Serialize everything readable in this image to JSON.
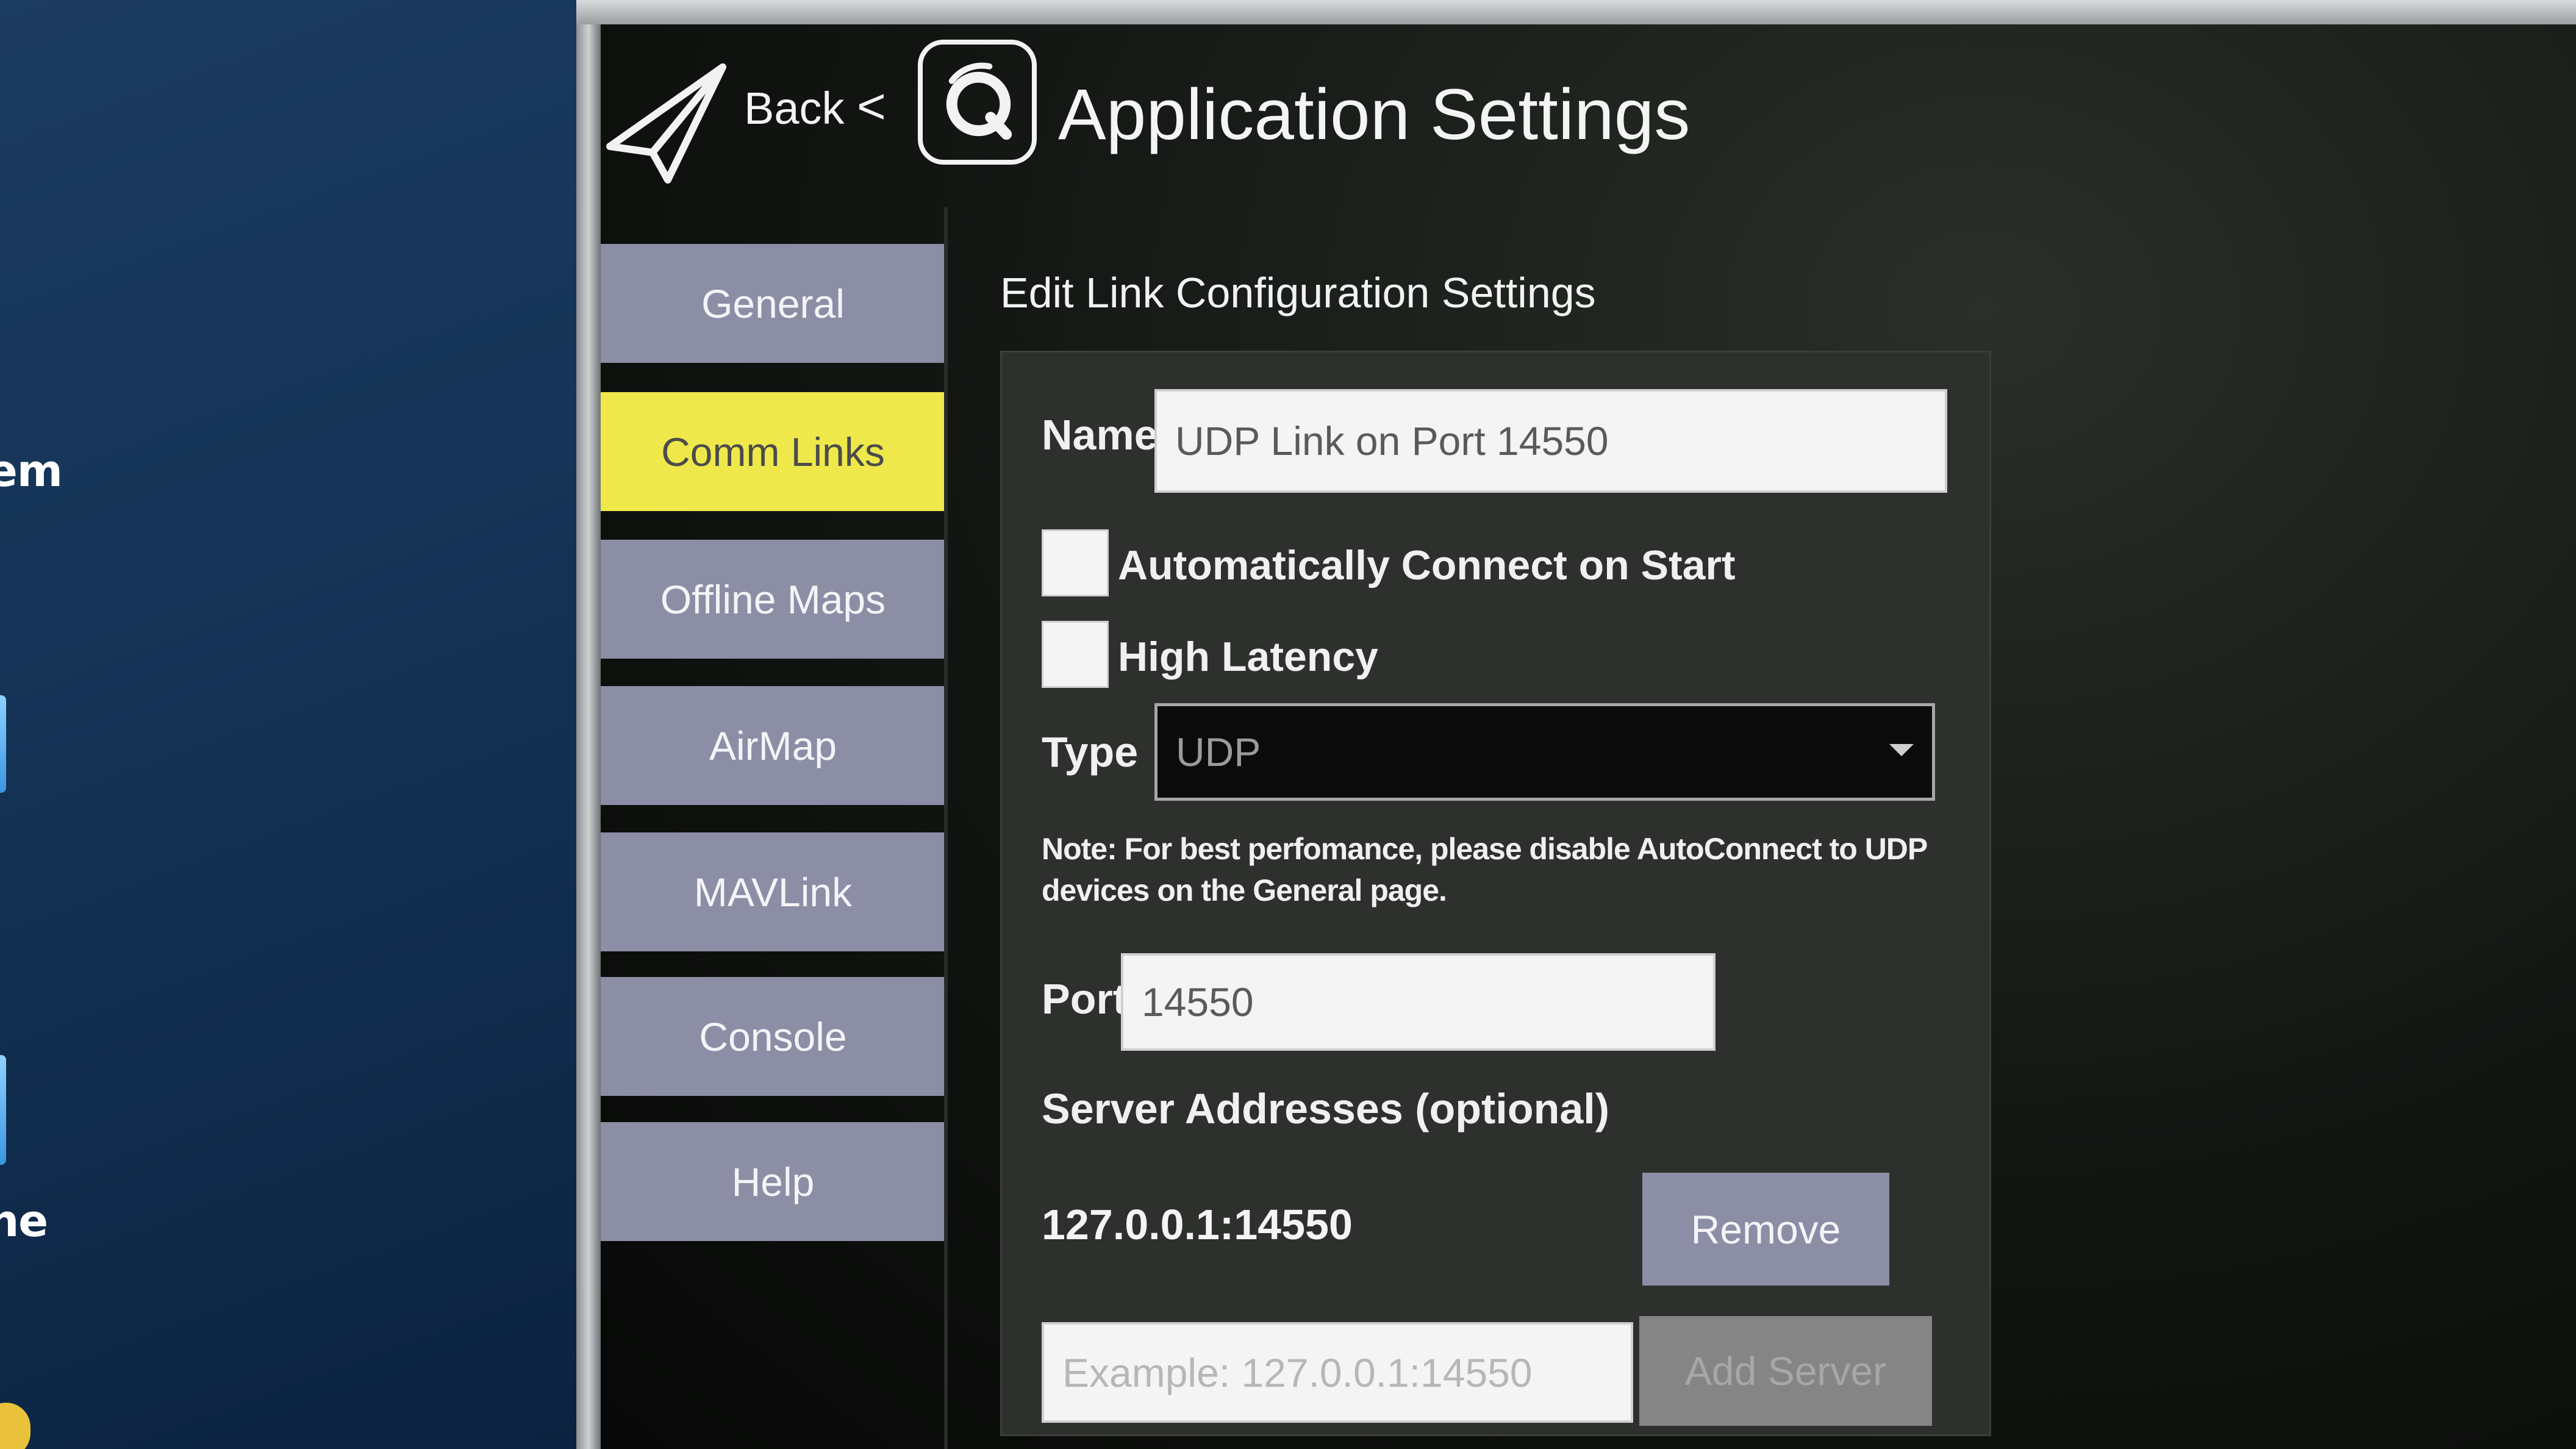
{
  "desktop": {
    "labels": [
      "em",
      "ne"
    ]
  },
  "header": {
    "back_label": "Back",
    "back_chevron": "<",
    "title": "Application Settings",
    "plane_icon": "paper-plane-icon",
    "logo_icon": "qgc-logo-icon"
  },
  "sidebar": {
    "items": [
      {
        "label": "General",
        "active": false
      },
      {
        "label": "Comm Links",
        "active": true
      },
      {
        "label": "Offline Maps",
        "active": false
      },
      {
        "label": "AirMap",
        "active": false
      },
      {
        "label": "MAVLink",
        "active": false
      },
      {
        "label": "Console",
        "active": false
      },
      {
        "label": "Help",
        "active": false
      }
    ]
  },
  "main": {
    "section_title": "Edit Link Configuration Settings",
    "name_label": "Name",
    "name_value": "UDP Link on Port 14550",
    "auto_connect_label": "Automatically Connect on Start",
    "auto_connect_checked": false,
    "high_latency_label": "High Latency",
    "high_latency_checked": false,
    "type_label": "Type",
    "type_value": "UDP",
    "note": "Note: For best perfomance, please disable AutoConnect to UDP devices on the General page.",
    "port_label": "Port",
    "port_value": "14550",
    "servers_label": "Server Addresses (optional)",
    "server_address": "127.0.0.1:14550",
    "remove_label": "Remove",
    "new_server_placeholder": "Example: 127.0.0.1:14550",
    "add_server_label": "Add Server"
  },
  "colors": {
    "nav_button": "#8c8ea5",
    "nav_active": "#efe84a",
    "panel": "#2e302d",
    "disabled_button": "#858585"
  }
}
